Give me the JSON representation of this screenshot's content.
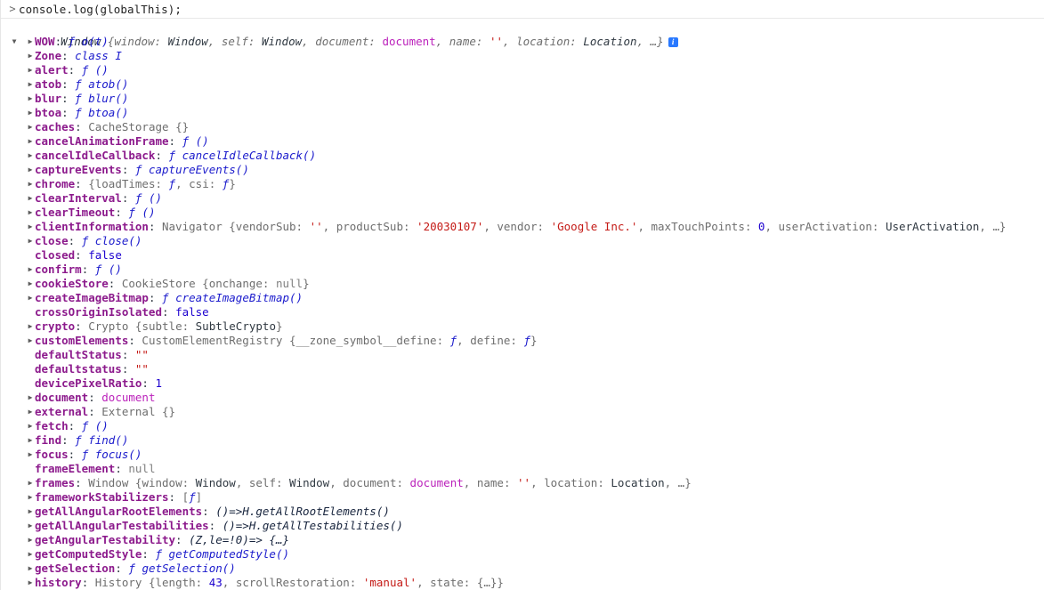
{
  "console": {
    "prompt": {
      "caret": "chevron-right-prompt",
      "caret_glyph": ">",
      "input_value": "console.log(globalThis);"
    },
    "header": {
      "expander": "expanded",
      "label": "Window",
      "preview": " {window: Window, self: Window, document: document, name: '', location: Location, …}",
      "preview_tokens": [
        {
          "t": " {",
          "c": "t-dimi"
        },
        {
          "t": "window",
          "c": "t-dimi"
        },
        {
          "t": ": ",
          "c": "t-dimi"
        },
        {
          "t": "Window",
          "c": "t-windowi"
        },
        {
          "t": ", ",
          "c": "t-dimi"
        },
        {
          "t": "self",
          "c": "t-dimi"
        },
        {
          "t": ": ",
          "c": "t-dimi"
        },
        {
          "t": "Window",
          "c": "t-windowi"
        },
        {
          "t": ", ",
          "c": "t-dimi"
        },
        {
          "t": "document",
          "c": "t-dimi"
        },
        {
          "t": ": ",
          "c": "t-dimi"
        },
        {
          "t": "document",
          "c": "t-node"
        },
        {
          "t": ", ",
          "c": "t-dimi"
        },
        {
          "t": "name",
          "c": "t-dimi"
        },
        {
          "t": ": ",
          "c": "t-dimi"
        },
        {
          "t": "''",
          "c": "t-str"
        },
        {
          "t": ", ",
          "c": "t-dimi"
        },
        {
          "t": "location",
          "c": "t-dimi"
        },
        {
          "t": ": ",
          "c": "t-dimi"
        },
        {
          "t": "Location",
          "c": "t-windowi"
        },
        {
          "t": ", …}",
          "c": "t-dimi"
        }
      ],
      "info_icon": "info-icon",
      "info_glyph": "i"
    },
    "properties": [
      {
        "expander": "closed",
        "name": "WOW",
        "value_tokens": [
          {
            "t": "ƒ ",
            "c": "t-fnsym"
          },
          {
            "t": "o(t)",
            "c": "t-fn"
          }
        ]
      },
      {
        "expander": "closed",
        "name": "Zone",
        "value_tokens": [
          {
            "t": "class ",
            "c": "t-classkw"
          },
          {
            "t": "I",
            "c": "t-classkw"
          }
        ]
      },
      {
        "expander": "closed",
        "name": "alert",
        "value_tokens": [
          {
            "t": "ƒ ",
            "c": "t-fnsym"
          },
          {
            "t": "()",
            "c": "t-fn"
          }
        ]
      },
      {
        "expander": "closed",
        "name": "atob",
        "value_tokens": [
          {
            "t": "ƒ ",
            "c": "t-fnsym"
          },
          {
            "t": "atob()",
            "c": "t-fn"
          }
        ]
      },
      {
        "expander": "closed",
        "name": "blur",
        "value_tokens": [
          {
            "t": "ƒ ",
            "c": "t-fnsym"
          },
          {
            "t": "blur()",
            "c": "t-fn"
          }
        ]
      },
      {
        "expander": "closed",
        "name": "btoa",
        "value_tokens": [
          {
            "t": "ƒ ",
            "c": "t-fnsym"
          },
          {
            "t": "btoa()",
            "c": "t-fn"
          }
        ]
      },
      {
        "expander": "closed",
        "name": "caches",
        "value_tokens": [
          {
            "t": "CacheStorage ",
            "c": "t-dim"
          },
          {
            "t": "{}",
            "c": "t-dim"
          }
        ]
      },
      {
        "expander": "closed",
        "name": "cancelAnimationFrame",
        "value_tokens": [
          {
            "t": "ƒ ",
            "c": "t-fnsym"
          },
          {
            "t": "()",
            "c": "t-fn"
          }
        ]
      },
      {
        "expander": "closed",
        "name": "cancelIdleCallback",
        "value_tokens": [
          {
            "t": "ƒ ",
            "c": "t-fnsym"
          },
          {
            "t": "cancelIdleCallback()",
            "c": "t-fn"
          }
        ]
      },
      {
        "expander": "closed",
        "name": "captureEvents",
        "value_tokens": [
          {
            "t": "ƒ ",
            "c": "t-fnsym"
          },
          {
            "t": "captureEvents()",
            "c": "t-fn"
          }
        ]
      },
      {
        "expander": "closed",
        "name": "chrome",
        "value_tokens": [
          {
            "t": "{",
            "c": "t-dim"
          },
          {
            "t": "loadTimes",
            "c": "t-dim"
          },
          {
            "t": ": ",
            "c": "t-dim"
          },
          {
            "t": "ƒ",
            "c": "t-fnsym"
          },
          {
            "t": ", ",
            "c": "t-dim"
          },
          {
            "t": "csi",
            "c": "t-dim"
          },
          {
            "t": ": ",
            "c": "t-dim"
          },
          {
            "t": "ƒ",
            "c": "t-fnsym"
          },
          {
            "t": "}",
            "c": "t-dim"
          }
        ]
      },
      {
        "expander": "closed",
        "name": "clearInterval",
        "value_tokens": [
          {
            "t": "ƒ ",
            "c": "t-fnsym"
          },
          {
            "t": "()",
            "c": "t-fn"
          }
        ]
      },
      {
        "expander": "closed",
        "name": "clearTimeout",
        "value_tokens": [
          {
            "t": "ƒ ",
            "c": "t-fnsym"
          },
          {
            "t": "()",
            "c": "t-fn"
          }
        ]
      },
      {
        "expander": "closed",
        "name": "clientInformation",
        "value_tokens": [
          {
            "t": "Navigator ",
            "c": "t-dim"
          },
          {
            "t": "{",
            "c": "t-dim"
          },
          {
            "t": "vendorSub",
            "c": "t-dim"
          },
          {
            "t": ": ",
            "c": "t-dim"
          },
          {
            "t": "''",
            "c": "t-str"
          },
          {
            "t": ", ",
            "c": "t-dim"
          },
          {
            "t": "productSub",
            "c": "t-dim"
          },
          {
            "t": ": ",
            "c": "t-dim"
          },
          {
            "t": "'20030107'",
            "c": "t-str"
          },
          {
            "t": ", ",
            "c": "t-dim"
          },
          {
            "t": "vendor",
            "c": "t-dim"
          },
          {
            "t": ": ",
            "c": "t-dim"
          },
          {
            "t": "'Google Inc.'",
            "c": "t-str"
          },
          {
            "t": ", ",
            "c": "t-dim"
          },
          {
            "t": "maxTouchPoints",
            "c": "t-dim"
          },
          {
            "t": ": ",
            "c": "t-dim"
          },
          {
            "t": "0",
            "c": "t-num"
          },
          {
            "t": ", ",
            "c": "t-dim"
          },
          {
            "t": "userActivation",
            "c": "t-dim"
          },
          {
            "t": ": ",
            "c": "t-dim"
          },
          {
            "t": "UserActivation",
            "c": "t-plain"
          },
          {
            "t": ", …}",
            "c": "t-dim"
          }
        ]
      },
      {
        "expander": "closed",
        "name": "close",
        "value_tokens": [
          {
            "t": "ƒ ",
            "c": "t-fnsym"
          },
          {
            "t": "close()",
            "c": "t-fn"
          }
        ]
      },
      {
        "expander": "none",
        "name": "closed",
        "value_tokens": [
          {
            "t": "false",
            "c": "t-bool"
          }
        ]
      },
      {
        "expander": "closed",
        "name": "confirm",
        "value_tokens": [
          {
            "t": "ƒ ",
            "c": "t-fnsym"
          },
          {
            "t": "()",
            "c": "t-fn"
          }
        ]
      },
      {
        "expander": "closed",
        "name": "cookieStore",
        "value_tokens": [
          {
            "t": "CookieStore ",
            "c": "t-dim"
          },
          {
            "t": "{",
            "c": "t-dim"
          },
          {
            "t": "onchange",
            "c": "t-dim"
          },
          {
            "t": ": ",
            "c": "t-dim"
          },
          {
            "t": "null",
            "c": "t-null"
          },
          {
            "t": "}",
            "c": "t-dim"
          }
        ]
      },
      {
        "expander": "closed",
        "name": "createImageBitmap",
        "value_tokens": [
          {
            "t": "ƒ ",
            "c": "t-fnsym"
          },
          {
            "t": "createImageBitmap()",
            "c": "t-fn"
          }
        ]
      },
      {
        "expander": "none",
        "name": "crossOriginIsolated",
        "value_tokens": [
          {
            "t": "false",
            "c": "t-bool"
          }
        ]
      },
      {
        "expander": "closed",
        "name": "crypto",
        "value_tokens": [
          {
            "t": "Crypto ",
            "c": "t-dim"
          },
          {
            "t": "{",
            "c": "t-dim"
          },
          {
            "t": "subtle",
            "c": "t-dim"
          },
          {
            "t": ": ",
            "c": "t-dim"
          },
          {
            "t": "SubtleCrypto",
            "c": "t-plain"
          },
          {
            "t": "}",
            "c": "t-dim"
          }
        ]
      },
      {
        "expander": "closed",
        "name": "customElements",
        "value_tokens": [
          {
            "t": "CustomElementRegistry ",
            "c": "t-dim"
          },
          {
            "t": "{",
            "c": "t-dim"
          },
          {
            "t": "__zone_symbol__define",
            "c": "t-dim"
          },
          {
            "t": ": ",
            "c": "t-dim"
          },
          {
            "t": "ƒ",
            "c": "t-fnsym"
          },
          {
            "t": ", ",
            "c": "t-dim"
          },
          {
            "t": "define",
            "c": "t-dim"
          },
          {
            "t": ": ",
            "c": "t-dim"
          },
          {
            "t": "ƒ",
            "c": "t-fnsym"
          },
          {
            "t": "}",
            "c": "t-dim"
          }
        ]
      },
      {
        "expander": "none",
        "name": "defaultStatus",
        "value_tokens": [
          {
            "t": "\"\"",
            "c": "t-str"
          }
        ]
      },
      {
        "expander": "none",
        "name": "defaultstatus",
        "value_tokens": [
          {
            "t": "\"\"",
            "c": "t-str"
          }
        ]
      },
      {
        "expander": "none",
        "name": "devicePixelRatio",
        "value_tokens": [
          {
            "t": "1",
            "c": "t-num"
          }
        ]
      },
      {
        "expander": "closed",
        "name": "document",
        "value_tokens": [
          {
            "t": "document",
            "c": "t-node"
          }
        ]
      },
      {
        "expander": "closed",
        "name": "external",
        "value_tokens": [
          {
            "t": "External ",
            "c": "t-dim"
          },
          {
            "t": "{}",
            "c": "t-dim"
          }
        ]
      },
      {
        "expander": "closed",
        "name": "fetch",
        "value_tokens": [
          {
            "t": "ƒ ",
            "c": "t-fnsym"
          },
          {
            "t": "()",
            "c": "t-fn"
          }
        ]
      },
      {
        "expander": "closed",
        "name": "find",
        "value_tokens": [
          {
            "t": "ƒ ",
            "c": "t-fnsym"
          },
          {
            "t": "find()",
            "c": "t-fn"
          }
        ]
      },
      {
        "expander": "closed",
        "name": "focus",
        "value_tokens": [
          {
            "t": "ƒ ",
            "c": "t-fnsym"
          },
          {
            "t": "focus()",
            "c": "t-fn"
          }
        ]
      },
      {
        "expander": "none",
        "name": "frameElement",
        "value_tokens": [
          {
            "t": "null",
            "c": "t-null"
          }
        ]
      },
      {
        "expander": "closed",
        "name": "frames",
        "value_tokens": [
          {
            "t": "Window ",
            "c": "t-dim"
          },
          {
            "t": "{",
            "c": "t-dim"
          },
          {
            "t": "window",
            "c": "t-dim"
          },
          {
            "t": ": ",
            "c": "t-dim"
          },
          {
            "t": "Window",
            "c": "t-plain"
          },
          {
            "t": ", ",
            "c": "t-dim"
          },
          {
            "t": "self",
            "c": "t-dim"
          },
          {
            "t": ": ",
            "c": "t-dim"
          },
          {
            "t": "Window",
            "c": "t-plain"
          },
          {
            "t": ", ",
            "c": "t-dim"
          },
          {
            "t": "document",
            "c": "t-dim"
          },
          {
            "t": ": ",
            "c": "t-dim"
          },
          {
            "t": "document",
            "c": "t-node"
          },
          {
            "t": ", ",
            "c": "t-dim"
          },
          {
            "t": "name",
            "c": "t-dim"
          },
          {
            "t": ": ",
            "c": "t-dim"
          },
          {
            "t": "''",
            "c": "t-str"
          },
          {
            "t": ", ",
            "c": "t-dim"
          },
          {
            "t": "location",
            "c": "t-dim"
          },
          {
            "t": ": ",
            "c": "t-dim"
          },
          {
            "t": "Location",
            "c": "t-plain"
          },
          {
            "t": ", …}",
            "c": "t-dim"
          }
        ]
      },
      {
        "expander": "closed",
        "name": "frameworkStabilizers",
        "value_tokens": [
          {
            "t": "[",
            "c": "t-dim"
          },
          {
            "t": "ƒ",
            "c": "t-fnsym"
          },
          {
            "t": "]",
            "c": "t-dim"
          }
        ]
      },
      {
        "expander": "closed",
        "name": "getAllAngularRootElements",
        "value_tokens": [
          {
            "t": "()=>H.getAllRootElements()",
            "c": "t-arrow"
          }
        ]
      },
      {
        "expander": "closed",
        "name": "getAllAngularTestabilities",
        "value_tokens": [
          {
            "t": "()=>H.getAllTestabilities()",
            "c": "t-arrow"
          }
        ]
      },
      {
        "expander": "closed",
        "name": "getAngularTestability",
        "value_tokens": [
          {
            "t": "(Z,le=!0)=> {…}",
            "c": "t-arrow"
          }
        ]
      },
      {
        "expander": "closed",
        "name": "getComputedStyle",
        "value_tokens": [
          {
            "t": "ƒ ",
            "c": "t-fnsym"
          },
          {
            "t": "getComputedStyle()",
            "c": "t-fn"
          }
        ]
      },
      {
        "expander": "closed",
        "name": "getSelection",
        "value_tokens": [
          {
            "t": "ƒ ",
            "c": "t-fnsym"
          },
          {
            "t": "getSelection()",
            "c": "t-fn"
          }
        ]
      },
      {
        "expander": "closed",
        "name": "history",
        "value_tokens": [
          {
            "t": "History ",
            "c": "t-dim"
          },
          {
            "t": "{",
            "c": "t-dim"
          },
          {
            "t": "length",
            "c": "t-dim"
          },
          {
            "t": ": ",
            "c": "t-dim"
          },
          {
            "t": "43",
            "c": "t-num"
          },
          {
            "t": ", ",
            "c": "t-dim"
          },
          {
            "t": "scrollRestoration",
            "c": "t-dim"
          },
          {
            "t": ": ",
            "c": "t-dim"
          },
          {
            "t": "'manual'",
            "c": "t-str"
          },
          {
            "t": ", ",
            "c": "t-dim"
          },
          {
            "t": "state",
            "c": "t-dim"
          },
          {
            "t": ": ",
            "c": "t-dim"
          },
          {
            "t": "{…}",
            "c": "t-dim"
          },
          {
            "t": "}",
            "c": "t-dim"
          }
        ]
      }
    ]
  }
}
